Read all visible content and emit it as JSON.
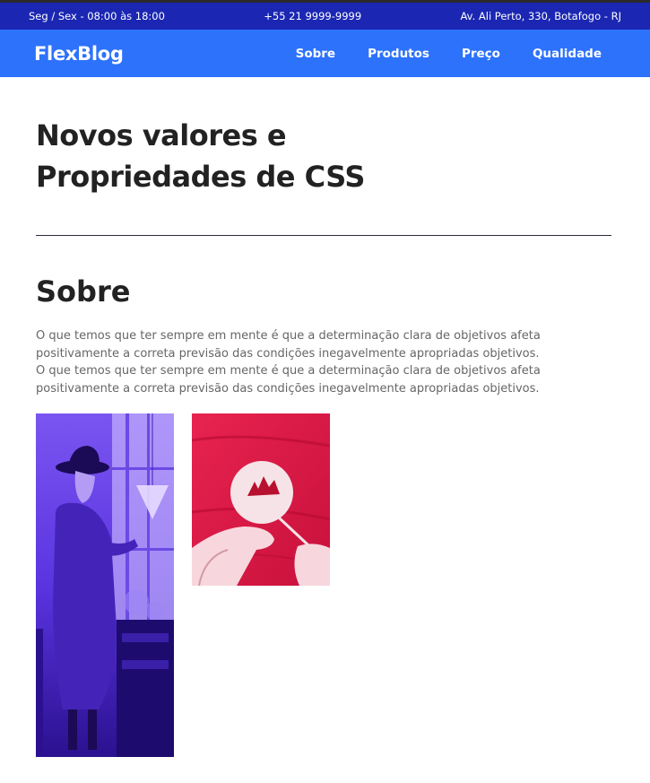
{
  "topbar": {
    "hours": "Seg / Sex - 08:00 às 18:00",
    "phone": "+55 21 9999-9999",
    "address": "Av. Ali Perto, 330, Botafogo - RJ"
  },
  "navbar": {
    "logo": "FlexBlog",
    "links": [
      "Sobre",
      "Produtos",
      "Preço",
      "Qualidade"
    ]
  },
  "hero": {
    "title_line1": "Novos valores e",
    "title_line2": "Propriedades de CSS"
  },
  "about": {
    "title": "Sobre",
    "paragraph1": "O que temos que ter sempre em mente é que a determinação clara de objetivos afeta positivamente a correta previsão das condições inegavelmente apropriadas objetivos.",
    "paragraph2": "O que temos que ter sempre em mente é que a determinação clara de objetivos afeta positivamente a correta previsão das condições inegavelmente apropriadas objetivos."
  },
  "colors": {
    "topbar": "#1b27b3",
    "navbar": "#2d72fb",
    "photo1_tint": "#5a2fe0",
    "photo2_tint": "#e8234f"
  }
}
